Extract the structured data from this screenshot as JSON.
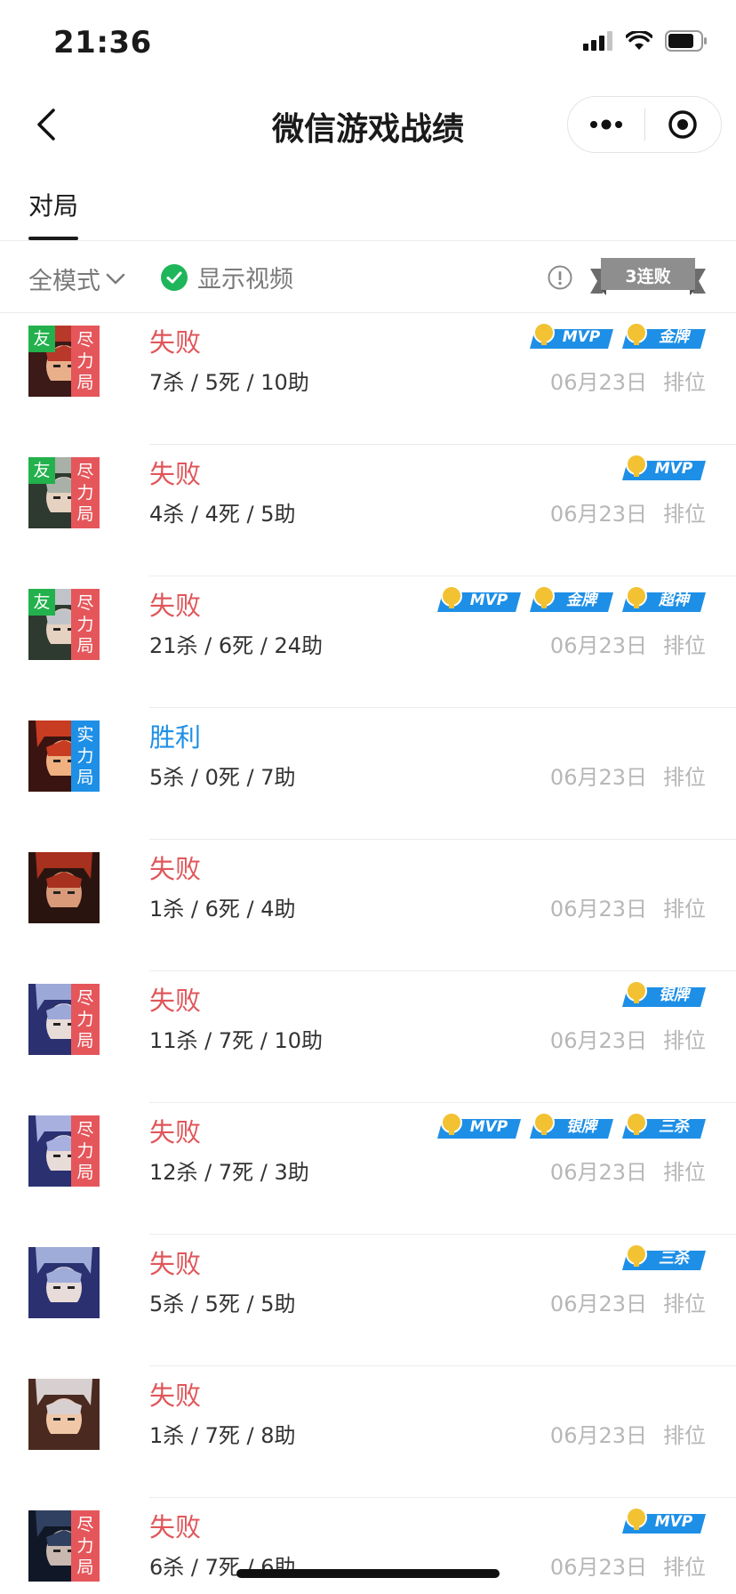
{
  "status": {
    "time": "21:36"
  },
  "nav": {
    "title": "微信游戏战绩"
  },
  "tabs": [
    {
      "label": "对局"
    }
  ],
  "filter": {
    "mode": "全模式",
    "video_label": "显示视频",
    "streak": "3连败"
  },
  "colors": {
    "lose": "#e0565a",
    "win": "#1e8fe6",
    "tag_red": "#e5565a",
    "tag_blue": "#1e8fe6",
    "friend": "#22b14c",
    "badge": "#1e8fe6",
    "meta": "#b7b7b7"
  },
  "matches": [
    {
      "friend": "友",
      "tag": "尽力局",
      "tag_color": "red",
      "result": "失败",
      "win": false,
      "kda": "7杀 / 5死 / 10助",
      "date": "06月23日",
      "mode": "排位",
      "badges": [
        "MVP",
        "金牌"
      ]
    },
    {
      "friend": "友",
      "tag": "尽力局",
      "tag_color": "red",
      "result": "失败",
      "win": false,
      "kda": "4杀 / 4死 / 5助",
      "date": "06月23日",
      "mode": "排位",
      "badges": [
        "MVP"
      ]
    },
    {
      "friend": "友",
      "tag": "尽力局",
      "tag_color": "red",
      "result": "失败",
      "win": false,
      "kda": "21杀 / 6死 / 24助",
      "date": "06月23日",
      "mode": "排位",
      "badges": [
        "MVP",
        "金牌",
        "超神"
      ]
    },
    {
      "friend": "",
      "tag": "实力局",
      "tag_color": "blue",
      "result": "胜利",
      "win": true,
      "kda": "5杀 / 0死 / 7助",
      "date": "06月23日",
      "mode": "排位",
      "badges": []
    },
    {
      "friend": "",
      "tag": "",
      "tag_color": "",
      "result": "失败",
      "win": false,
      "kda": "1杀 / 6死 / 4助",
      "date": "06月23日",
      "mode": "排位",
      "badges": []
    },
    {
      "friend": "",
      "tag": "尽力局",
      "tag_color": "red",
      "result": "失败",
      "win": false,
      "kda": "11杀 / 7死 / 10助",
      "date": "06月23日",
      "mode": "排位",
      "badges": [
        "银牌"
      ]
    },
    {
      "friend": "",
      "tag": "尽力局",
      "tag_color": "red",
      "result": "失败",
      "win": false,
      "kda": "12杀 / 7死 / 3助",
      "date": "06月23日",
      "mode": "排位",
      "badges": [
        "MVP",
        "银牌",
        "三杀"
      ]
    },
    {
      "friend": "",
      "tag": "",
      "tag_color": "",
      "result": "失败",
      "win": false,
      "kda": "5杀 / 5死 / 5助",
      "date": "06月23日",
      "mode": "排位",
      "badges": [
        "三杀"
      ]
    },
    {
      "friend": "",
      "tag": "",
      "tag_color": "",
      "result": "失败",
      "win": false,
      "kda": "1杀 / 7死 / 8助",
      "date": "06月23日",
      "mode": "排位",
      "badges": []
    },
    {
      "friend": "",
      "tag": "尽力局",
      "tag_color": "red",
      "result": "失败",
      "win": false,
      "kda": "6杀 / 7死 / 6助",
      "date": "06月23日",
      "mode": "排位",
      "badges": [
        "MVP"
      ]
    }
  ]
}
